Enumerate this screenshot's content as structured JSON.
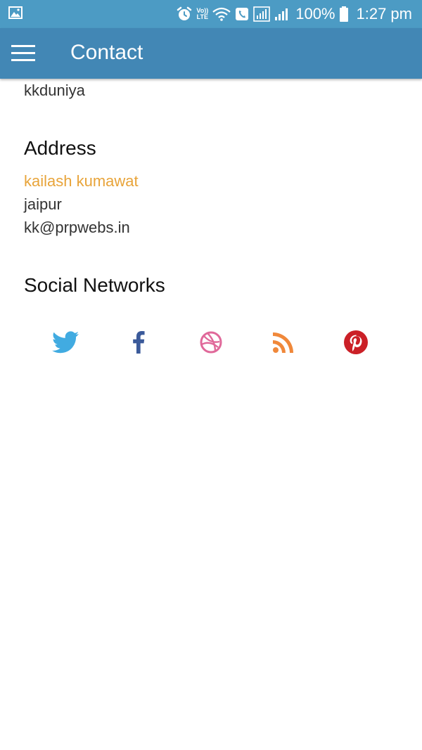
{
  "status_bar": {
    "battery_text": "100%",
    "time": "1:27 pm",
    "volte_top": "Vo))",
    "volte_bottom": "LTE"
  },
  "app_bar": {
    "title": "Contact"
  },
  "contact": {
    "top_line": "kkduniya"
  },
  "address": {
    "heading": "Address",
    "name": "kailash kumawat",
    "city": "jaipur",
    "email": "kk@prpwebs.in"
  },
  "social": {
    "heading": "Social Networks",
    "icons": [
      "twitter-icon",
      "facebook-icon",
      "dribbble-icon",
      "rss-icon",
      "pinterest-icon"
    ]
  },
  "colors": {
    "status_bar": "#4c9bc4",
    "app_bar": "#4287b5",
    "accent": "#e8a43a",
    "twitter": "#41abe1",
    "facebook": "#3b5a9a",
    "dribbble": "#e0699a",
    "rss": "#f0883a",
    "pinterest": "#cb2027"
  }
}
